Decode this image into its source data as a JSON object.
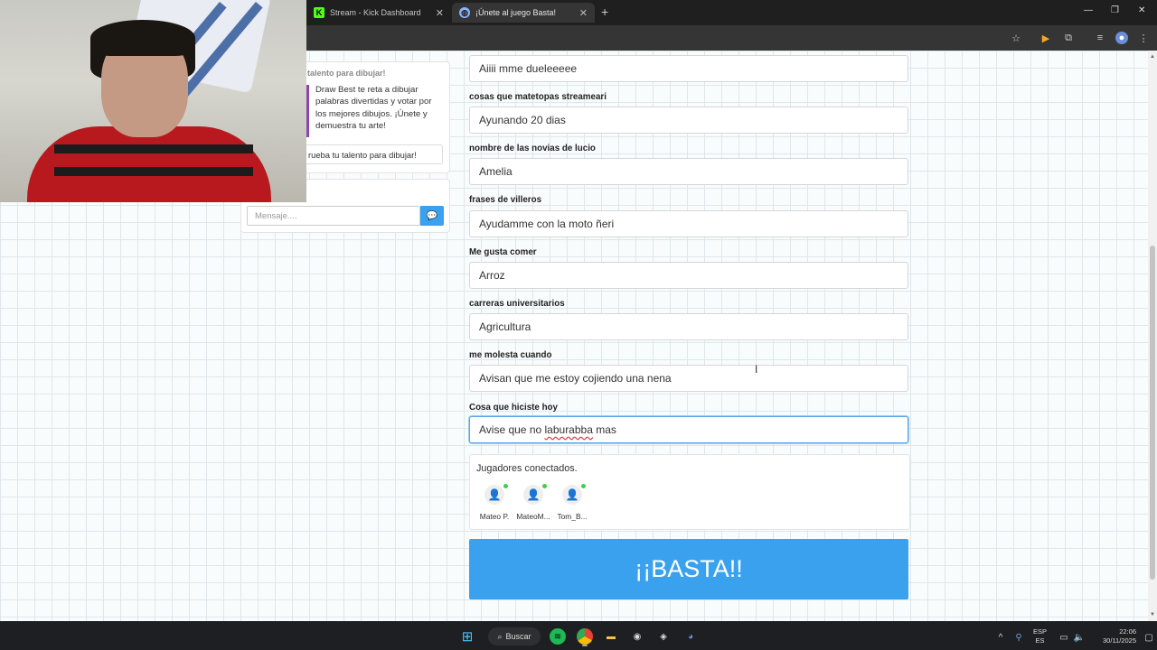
{
  "browser": {
    "tabs": [
      {
        "title": "Stream - Kick Dashboard",
        "icon": "kick-icon"
      },
      {
        "title": "¡Únete al juego Basta!",
        "icon": "globe-icon"
      }
    ]
  },
  "sidebar": {
    "title": "talento para dibujar!",
    "description": "Draw Best te reta a dibujar palabras divertidas y votar por los mejores dibujos. ¡Únete y demuestra tu arte!",
    "button_label": "rueba tu talento para dibujar!",
    "chat_placeholder": "Mensaje...."
  },
  "form": {
    "fields": [
      {
        "label": "",
        "value": "Aiiii mme dueleeeee"
      },
      {
        "label": "cosas que matetopas streameari",
        "value": "Ayunando 20 dias"
      },
      {
        "label": "nombre de las novias de lucio",
        "value": "Amelia"
      },
      {
        "label": "frases de villeros",
        "value": "Ayudamme con la moto ñeri"
      },
      {
        "label": "Me gusta comer",
        "value": "Arroz"
      },
      {
        "label": "carreras universitarios",
        "value": "Agricultura"
      },
      {
        "label": "me molesta cuando",
        "value": "Avisan que me estoy cojiendo una nena"
      },
      {
        "label": "Cosa que hiciste hoy",
        "value_prefix": "Avise que no ",
        "value_misspelled": "laburabba",
        "value_suffix": " mas"
      }
    ]
  },
  "players": {
    "title": "Jugadores conectados.",
    "list": [
      "Mateo P.",
      "MateoM...",
      "Tom_B..."
    ]
  },
  "basta_label": "¡¡BASTA!!",
  "taskbar": {
    "search_label": "Buscar",
    "lang_top": "ESP",
    "lang_bottom": "ES",
    "time": "22:06",
    "date": "30/11/2025"
  },
  "colors": {
    "accent": "#3aa1ee",
    "online": "#3ecf4a"
  }
}
